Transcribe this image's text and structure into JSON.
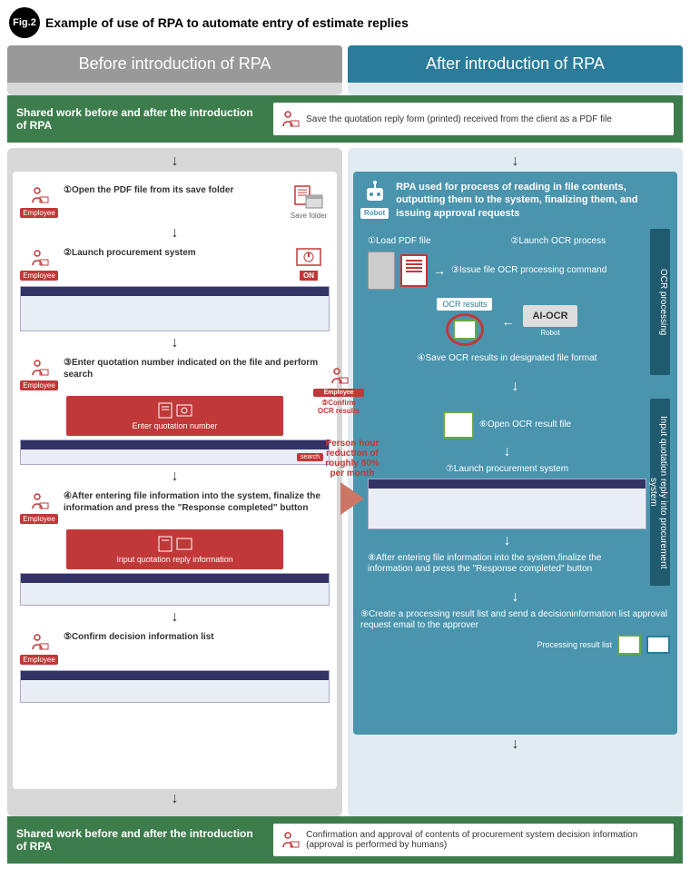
{
  "figure": {
    "num": "Fig.2",
    "title": "Example of use of RPA to automate entry of estimate replies"
  },
  "columns": {
    "left": "Before introduction of RPA",
    "right": "After introduction of RPA"
  },
  "shared_top": {
    "left": "Shared work before and after the introduction of RPA",
    "right": "Save the quotation reply form (printed) received from the client as a PDF file"
  },
  "shared_bottom": {
    "left": "Shared work before and after the introduction of RPA",
    "right": "Confirmation and approval of contents of procurement system decision information (approval is performed by humans)"
  },
  "before": {
    "employee": "Employee",
    "save_folder": "Save folder",
    "on": "ON",
    "s1": "①Open the PDF file from its save folder",
    "s2": "②Launch procurement system",
    "s3": "③Enter quotation number indicated on the file and perform search",
    "red1": "Enter quotation number",
    "search": "search",
    "s4": "④After entering file information into the system, finalize the information and press the \"Response completed\" button",
    "red2": "Input quotation reply information",
    "s5": "⑤Confirm decision information list"
  },
  "middle": {
    "text": "Person hour reduction of roughly 80% per month"
  },
  "after": {
    "robot": "Robot",
    "desc": "RPA used for process of reading in file contents, outputting them to the system, finalizing them, and issuing approval requests",
    "ocr_bar": "OCR processing",
    "input_bar": "Input quotation reply into procurement system",
    "s1": "①Load PDF file",
    "s2": "②Launch OCR process",
    "s3": "③Issue file OCR processing command",
    "ocr_results": "OCR results",
    "ai_ocr": "AI-OCR",
    "ai_robot": "Robot",
    "s4": "④Save OCR results in designated file format",
    "s5": "⑤Confirm OCR results",
    "confirm_emp": "Employee",
    "s6": "⑥Open OCR result file",
    "s7": "⑦Launch procurement system",
    "s8": "⑧After entering file information into the system,finalize the information and press the \"Response completed\" button",
    "s9": "⑨Create a processing result list and send a decisioninformation list approval request email to the approver",
    "proc_list": "Processing result list"
  }
}
